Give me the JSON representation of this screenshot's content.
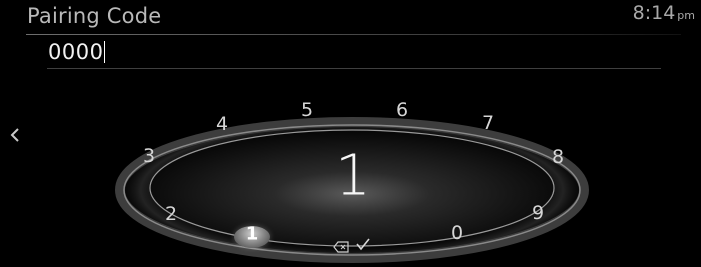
{
  "header": {
    "title": "Pairing Code",
    "clock_time": "8:14",
    "clock_ampm": "pm"
  },
  "code_entry": {
    "value": "0000"
  },
  "dial": {
    "digits": [
      "4",
      "5",
      "6",
      "7",
      "3",
      "8",
      "2",
      "9",
      "0"
    ],
    "current_digit": "1",
    "selected_digit": "1"
  },
  "icons": {
    "back": "chevron-left-icon",
    "backspace": "backspace-icon",
    "confirm": "checkmark-icon"
  },
  "colors": {
    "background": "#000000",
    "text": "#e8e8e8",
    "title": "#b9b9b9"
  }
}
